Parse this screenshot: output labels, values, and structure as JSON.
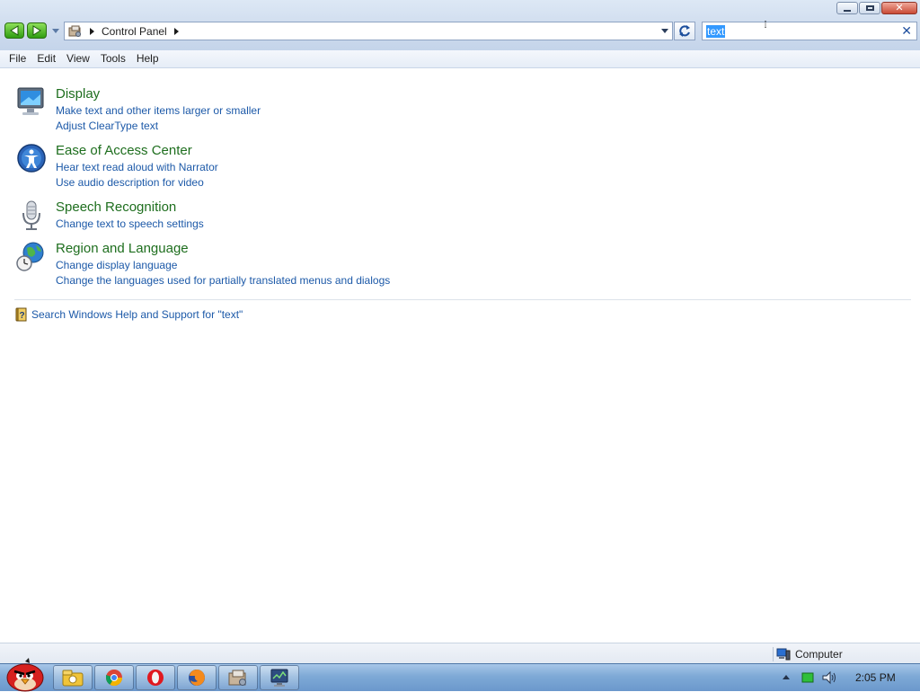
{
  "address_bar": {
    "breadcrumb": [
      "Control Panel"
    ]
  },
  "search": {
    "value": "text"
  },
  "menu": {
    "items": [
      "File",
      "Edit",
      "View",
      "Tools",
      "Help"
    ]
  },
  "results": [
    {
      "title": "Display",
      "icon": "display-icon",
      "links": [
        "Make text and other items larger or smaller",
        "Adjust ClearType text"
      ]
    },
    {
      "title": "Ease of Access Center",
      "icon": "ease-of-access-icon",
      "links": [
        "Hear text read aloud with Narrator",
        "Use audio description for video"
      ]
    },
    {
      "title": "Speech Recognition",
      "icon": "microphone-icon",
      "links": [
        "Change text to speech settings"
      ]
    },
    {
      "title": "Region and Language",
      "icon": "globe-clock-icon",
      "links": [
        "Change display language",
        "Change the languages used for partially translated menus and dialogs"
      ]
    }
  ],
  "help": {
    "label": "Search Windows Help and Support for \"text\""
  },
  "status_bar": {
    "location": "Computer"
  },
  "taskbar": {
    "clock": "2:05 PM",
    "apps": [
      "angry-birds-start-icon",
      "windows-explorer-icon",
      "chrome-icon",
      "opera-icon",
      "firefox-icon",
      "control-panel-icon",
      "system-monitor-icon"
    ]
  },
  "colors": {
    "title_green": "#1e6e1e",
    "link_blue": "#1c59a8",
    "selection_blue": "#3399ff"
  }
}
